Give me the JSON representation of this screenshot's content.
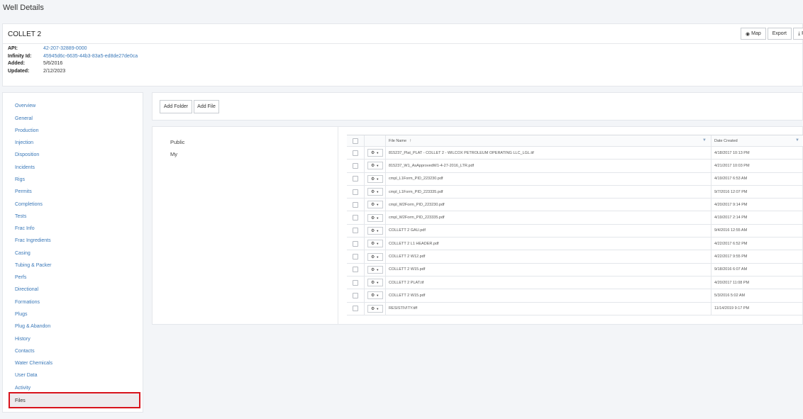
{
  "page": {
    "title": "Well Details"
  },
  "well": {
    "name": "COLLET 2",
    "info": [
      {
        "label": "API:",
        "value": "42-207-32889-0000",
        "link": true
      },
      {
        "label": "Infinity Id:",
        "value": "45945d6c-6635-44b3-83a5-ed8de27de0ca",
        "link": true
      },
      {
        "label": "Added:",
        "value": "5/6/2016",
        "link": false
      },
      {
        "label": "Updated:",
        "value": "2/12/2023",
        "link": false
      }
    ],
    "buttons": {
      "map": "Map",
      "export": "Export",
      "report": "Re"
    }
  },
  "sidebar": {
    "items": [
      "Overview",
      "General",
      "Production",
      "Injection",
      "Disposition",
      "Incidents",
      "Rigs",
      "Permits",
      "Completions",
      "Tests",
      "Frac Info",
      "Frac Ingredients",
      "Casing",
      "Tubing & Packer",
      "Perfs",
      "Directional",
      "Formations",
      "Plugs",
      "Plug & Abandon",
      "History",
      "Contacts",
      "Water Chemicals",
      "User Data",
      "Activity",
      "Files"
    ],
    "active": "Files"
  },
  "toolbar": {
    "add_folder": "Add Folder",
    "add_file": "Add File"
  },
  "folders": [
    "Public",
    "My"
  ],
  "grid": {
    "columns": {
      "name": "File Name",
      "date": "Date Created"
    },
    "rows": [
      {
        "name": "815237_Plat_PLAT - COLLET 2 - WILCOX PETROLEUM OPERATING LLC_LGL.tif",
        "date": "4/18/2017 10:13 PM"
      },
      {
        "name": "815237_W1_AsApprovedW1-4-27-2016_LTR.pdf",
        "date": "4/21/2017 10:03 PM"
      },
      {
        "name": "cmpl_L1Form_PID_223230.pdf",
        "date": "4/19/2017 6:53 AM"
      },
      {
        "name": "cmpl_L1Form_PID_223335.pdf",
        "date": "9/7/2016 12:07 PM"
      },
      {
        "name": "cmpl_W2Form_PID_223230.pdf",
        "date": "4/20/2017 9:14 PM"
      },
      {
        "name": "cmpl_W2Form_PID_223335.pdf",
        "date": "4/19/2017 2:14 PM"
      },
      {
        "name": "COLLETT 2 GAU.pdf",
        "date": "9/4/2016 12:55 AM"
      },
      {
        "name": "COLLETT 2 L1 HEADER.pdf",
        "date": "4/22/2017 6:52 PM"
      },
      {
        "name": "COLLETT 2 W12.pdf",
        "date": "4/22/2017 9:55 PM"
      },
      {
        "name": "COLLETT 2 W15.pdf",
        "date": "9/18/2016 6:07 AM"
      },
      {
        "name": "COLLETT 2 PLAT.tif",
        "date": "4/20/2017 11:08 PM"
      },
      {
        "name": "COLLETT 2 W15.pdf",
        "date": "5/3/2016 5:02 AM"
      },
      {
        "name": "RESISTIVITY.tiff",
        "date": "11/14/2019 9:17 PM"
      }
    ]
  }
}
